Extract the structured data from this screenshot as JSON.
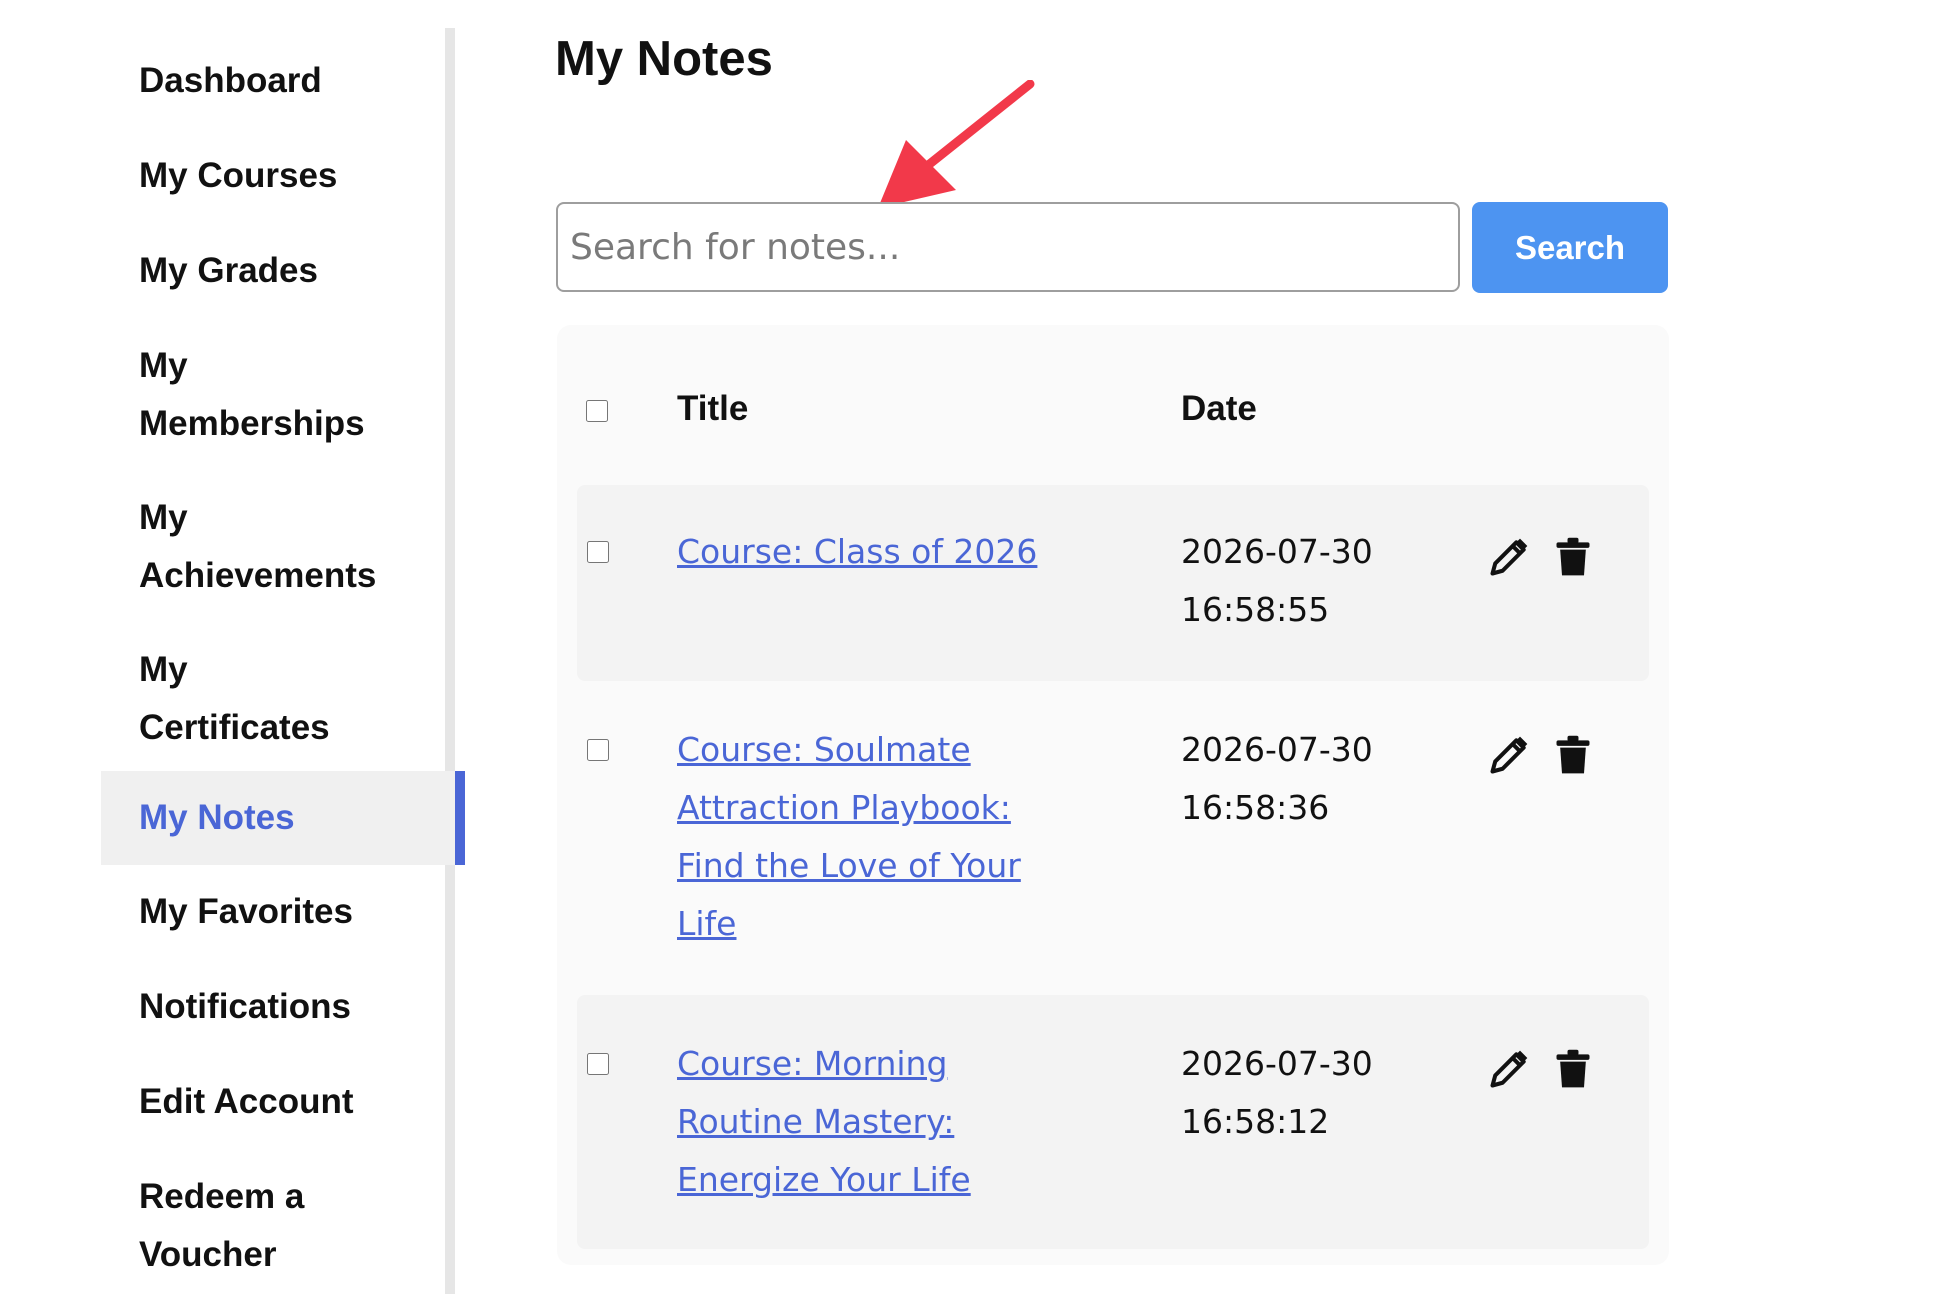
{
  "sidebar": {
    "items": [
      {
        "lines": [
          "Dashboard"
        ],
        "active": false
      },
      {
        "lines": [
          "My Courses"
        ],
        "active": false
      },
      {
        "lines": [
          "My Grades"
        ],
        "active": false
      },
      {
        "lines": [
          "My",
          "Memberships"
        ],
        "active": false
      },
      {
        "lines": [
          "My",
          "Achievements"
        ],
        "active": false
      },
      {
        "lines": [
          "My",
          "Certificates"
        ],
        "active": false
      },
      {
        "lines": [
          "My Notes"
        ],
        "active": true
      },
      {
        "lines": [
          "My Favorites"
        ],
        "active": false
      },
      {
        "lines": [
          "Notifications"
        ],
        "active": false
      },
      {
        "lines": [
          "Edit Account"
        ],
        "active": false
      },
      {
        "lines": [
          "Redeem a",
          "Voucher"
        ],
        "active": false
      }
    ]
  },
  "main": {
    "title": "My Notes",
    "search": {
      "placeholder": "Search for notes...",
      "value": "",
      "button_label": "Search"
    },
    "table": {
      "headers": {
        "title": "Title",
        "date": "Date"
      },
      "rows": [
        {
          "title_lines": [
            "Course: Class of 2026"
          ],
          "date": "2026-07-30",
          "time": "16:58:55"
        },
        {
          "title_lines": [
            "Course: Soulmate",
            "Attraction Playbook:",
            "Find the Love of Your",
            "Life"
          ],
          "date": "2026-07-30",
          "time": "16:58:36"
        },
        {
          "title_lines": [
            "Course: Morning",
            "Routine Mastery:",
            "Energize Your Life"
          ],
          "date": "2026-07-30",
          "time": "16:58:12"
        }
      ]
    }
  },
  "icons": {
    "edit": "pencil-icon",
    "delete": "trash-icon",
    "annotation": "red-arrow-icon"
  },
  "colors": {
    "accent": "#4a66d6",
    "button": "#4d94f1",
    "arrow": "#f2394a"
  }
}
